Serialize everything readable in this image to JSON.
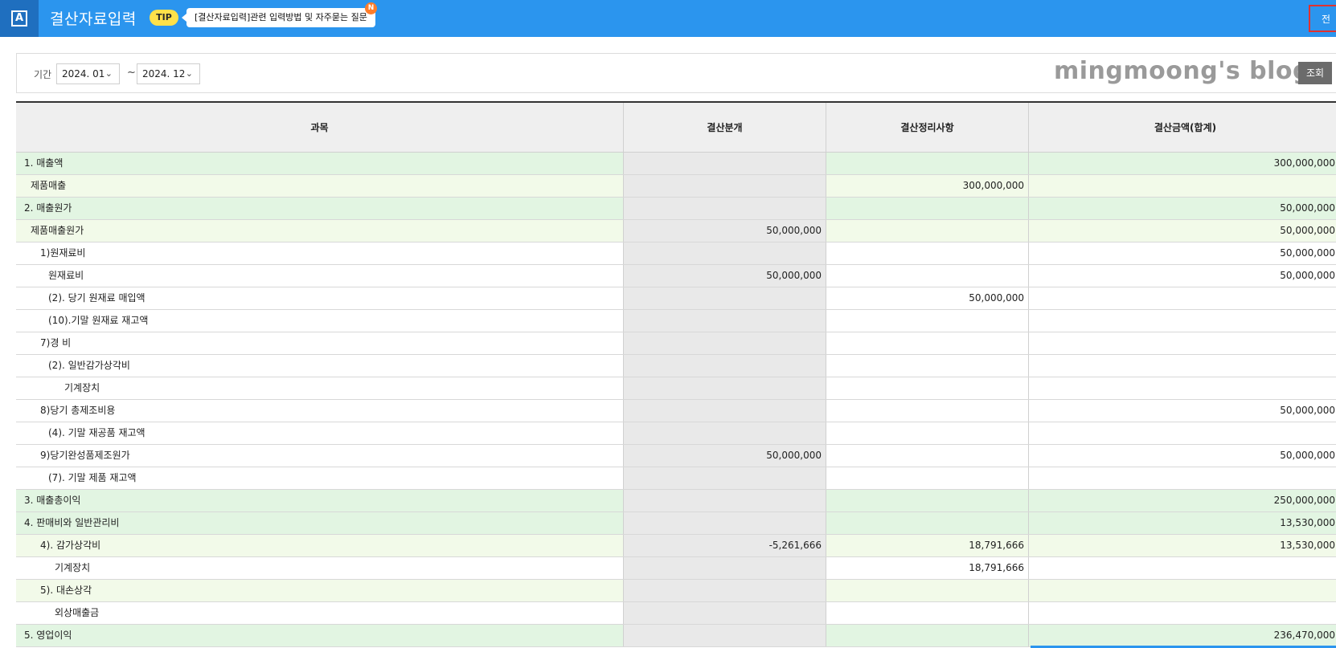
{
  "header": {
    "logo_letter": "A",
    "title": "결산자료입력",
    "tip_label": "TIP",
    "tip_text": "[결산자료입력]관련 입력방법 및 자주묻는 질문",
    "new_badge": "N",
    "corner_button": "전"
  },
  "filter": {
    "period_label": "기간",
    "start": "2024. 01",
    "separator": "~",
    "end": "2024. 12",
    "watermark": "mingmoong's blog",
    "query_button": "조회"
  },
  "table": {
    "headers": [
      "과목",
      "결산분개",
      "결산정리사항",
      "결산금액(합계)"
    ],
    "rows": [
      {
        "item": "1. 매출액",
        "journal": "",
        "adjust": "",
        "total": "300,000,000",
        "level": "lv1",
        "indent": 0
      },
      {
        "item": "제품매출",
        "journal": "",
        "adjust": "300,000,000",
        "total": "",
        "level": "lv2",
        "indent": 1
      },
      {
        "item": "2. 매출원가",
        "journal": "",
        "adjust": "",
        "total": "50,000,000",
        "level": "lv1",
        "indent": 0
      },
      {
        "item": "제품매출원가",
        "journal": "50,000,000",
        "adjust": "",
        "total": "50,000,000",
        "level": "lv2",
        "indent": 1
      },
      {
        "item": "1)원재료비",
        "journal": "",
        "adjust": "",
        "total": "50,000,000",
        "level": "plain",
        "indent": 2
      },
      {
        "item": "원재료비",
        "journal": "50,000,000",
        "adjust": "",
        "total": "50,000,000",
        "level": "plain",
        "indent": 3
      },
      {
        "item": "(2). 당기 원재료 매입액",
        "journal": "",
        "adjust": "50,000,000",
        "total": "",
        "level": "plain",
        "indent": 3
      },
      {
        "item": "(10).기말 원재료 재고액",
        "journal": "",
        "adjust": "",
        "total": "",
        "level": "plain",
        "indent": 3
      },
      {
        "item": "7)경  비",
        "journal": "",
        "adjust": "",
        "total": "",
        "level": "plain",
        "indent": 2
      },
      {
        "item": "(2). 일반감가상각비",
        "journal": "",
        "adjust": "",
        "total": "",
        "level": "plain",
        "indent": 3
      },
      {
        "item": "기계장치",
        "journal": "",
        "adjust": "",
        "total": "",
        "level": "plain",
        "indent": 4
      },
      {
        "item": "8)당기 총제조비용",
        "journal": "",
        "adjust": "",
        "total": "50,000,000",
        "level": "plain",
        "indent": 2
      },
      {
        "item": "(4). 기말 재공품 재고액",
        "journal": "",
        "adjust": "",
        "total": "",
        "level": "plain",
        "indent": 3
      },
      {
        "item": "9)당기완성품제조원가",
        "journal": "50,000,000",
        "adjust": "",
        "total": "50,000,000",
        "level": "plain",
        "indent": 2
      },
      {
        "item": "(7). 기말 제품 재고액",
        "journal": "",
        "adjust": "",
        "total": "",
        "level": "plain",
        "indent": 3
      },
      {
        "item": "3. 매출총이익",
        "journal": "",
        "adjust": "",
        "total": "250,000,000",
        "level": "lv1",
        "indent": 0
      },
      {
        "item": "4. 판매비와 일반관리비",
        "journal": "",
        "adjust": "",
        "total": "13,530,000",
        "level": "lv1",
        "indent": 0
      },
      {
        "item": "4). 감가상각비",
        "journal": "-5,261,666",
        "adjust": "18,791,666",
        "total": "13,530,000",
        "level": "lv2",
        "indent": 2
      },
      {
        "item": "기계장치",
        "journal": "",
        "adjust": "18,791,666",
        "total": "",
        "level": "plain",
        "indent": 5
      },
      {
        "item": "5). 대손상각",
        "journal": "",
        "adjust": "",
        "total": "",
        "level": "lv2",
        "indent": 2
      },
      {
        "item": "외상매출금",
        "journal": "",
        "adjust": "",
        "total": "",
        "level": "plain",
        "indent": 5
      },
      {
        "item": "5. 영업이익",
        "journal": "",
        "adjust": "",
        "total": "236,470,000",
        "level": "lv1",
        "indent": 0
      }
    ]
  },
  "colors": {
    "header_blue": "#2b95ee",
    "logo_dark_blue": "#1f6fbf",
    "tip_yellow": "#ffe14a",
    "new_orange": "#ff7d2a",
    "section_green": "#e2f5e2",
    "subsection_green": "#f2fae9",
    "journal_gray": "#e9e9e9"
  }
}
